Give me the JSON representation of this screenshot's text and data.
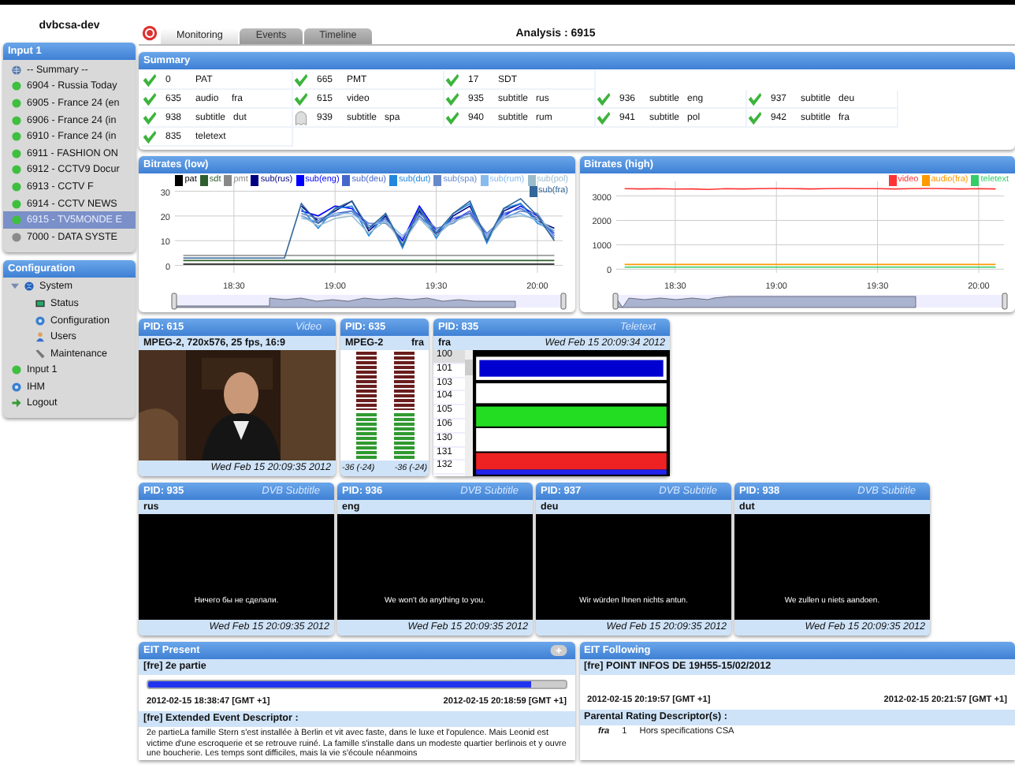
{
  "host": "dvbcsa-dev",
  "input_panel": {
    "title": "Input 1",
    "items": [
      {
        "label": "-- Summary --",
        "kind": "summary",
        "selected": false
      },
      {
        "label": "6904 - Russia Today",
        "kind": "service",
        "color": "#3fbf3f",
        "selected": false
      },
      {
        "label": "6905 - France 24 (en",
        "kind": "service",
        "color": "#3fbf3f",
        "selected": false
      },
      {
        "label": "6906 - France 24 (in",
        "kind": "service",
        "color": "#3fbf3f",
        "selected": false
      },
      {
        "label": "6910 - France 24 (in",
        "kind": "service",
        "color": "#3fbf3f",
        "selected": false
      },
      {
        "label": "6911 - FASHION ON",
        "kind": "service",
        "color": "#3fbf3f",
        "selected": false
      },
      {
        "label": "6912 - CCTV9 Docur",
        "kind": "service",
        "color": "#3fbf3f",
        "selected": false
      },
      {
        "label": "6913 - CCTV F",
        "kind": "service",
        "color": "#3fbf3f",
        "selected": false
      },
      {
        "label": "6914 - CCTV NEWS",
        "kind": "service",
        "color": "#3fbf3f",
        "selected": false
      },
      {
        "label": "6915 - TV5MONDE E",
        "kind": "service",
        "color": "#3fbf3f",
        "selected": true
      },
      {
        "label": "7000 - DATA SYSTE",
        "kind": "service",
        "color": "#8a8a8a",
        "selected": false
      }
    ]
  },
  "config_panel": {
    "title": "Configuration",
    "items": [
      {
        "label": "System",
        "kind": "system",
        "expanded": true,
        "children": [
          {
            "label": "Status",
            "kind": "status"
          },
          {
            "label": "Configuration",
            "kind": "gear"
          },
          {
            "label": "Users",
            "kind": "user"
          },
          {
            "label": "Maintenance",
            "kind": "wrench"
          }
        ]
      },
      {
        "label": "Input 1",
        "kind": "input"
      },
      {
        "label": "IHM",
        "kind": "gear"
      },
      {
        "label": "Logout",
        "kind": "logout"
      }
    ]
  },
  "tabs": [
    {
      "label": "Monitoring",
      "selected": true
    },
    {
      "label": "Events",
      "selected": false
    },
    {
      "label": "Timeline",
      "selected": false
    }
  ],
  "analysis_title": "Analysis : 6915",
  "summary": {
    "title": "Summary",
    "rows": [
      [
        {
          "pid": "0",
          "type": "PAT",
          "ok": true
        },
        {
          "pid": "665",
          "type": "PMT",
          "ok": true
        },
        {
          "pid": "17",
          "type": "SDT",
          "ok": true
        }
      ],
      [
        {
          "pid": "635",
          "type": "audio",
          "lang": "fra",
          "ok": true
        },
        {
          "pid": "615",
          "type": "video",
          "ok": true
        },
        {
          "pid": "935",
          "type": "subtitle",
          "lang": "rus",
          "ok": true
        },
        {
          "pid": "936",
          "type": "subtitle",
          "lang": "eng",
          "ok": true
        },
        {
          "pid": "937",
          "type": "subtitle",
          "lang": "deu",
          "ok": true
        }
      ],
      [
        {
          "pid": "938",
          "type": "subtitle",
          "lang": "dut",
          "ok": true
        },
        {
          "pid": "939",
          "type": "subtitle",
          "lang": "spa",
          "ok": false
        },
        {
          "pid": "940",
          "type": "subtitle",
          "lang": "rum",
          "ok": true
        },
        {
          "pid": "941",
          "type": "subtitle",
          "lang": "pol",
          "ok": true
        },
        {
          "pid": "942",
          "type": "subtitle",
          "lang": "fra",
          "ok": true
        }
      ],
      [
        {
          "pid": "835",
          "type": "teletext",
          "ok": true
        }
      ]
    ]
  },
  "bitrates_low": {
    "title": "Bitrates (low)",
    "chart_data": {
      "type": "line",
      "categories": [
        null,
        null,
        null,
        "18:30",
        null,
        null,
        null,
        null,
        null,
        "19:00",
        null,
        null,
        null,
        null,
        null,
        "19:30",
        null,
        null,
        null,
        null,
        null,
        "20:00",
        null
      ],
      "ylim": [
        -3,
        34
      ],
      "yticks": [
        0,
        10,
        20,
        30
      ],
      "grid": true,
      "legend": "top-right",
      "series": [
        {
          "name": "pat",
          "color": "#000000",
          "values": [
            0.5,
            0.5,
            0.5,
            0.5,
            0.5,
            0.5,
            0.5,
            0.5,
            0.5,
            0.5,
            0.5,
            0.5,
            0.5,
            0.5,
            0.5,
            0.5,
            0.5,
            0.5,
            0.5,
            0.5,
            0.5,
            0.5,
            0.5
          ]
        },
        {
          "name": "sdt",
          "color": "#2e5e2e",
          "values": [
            2,
            2,
            2,
            2,
            2,
            2,
            2,
            2,
            2,
            2,
            2,
            2,
            2,
            2,
            2,
            2,
            2,
            2,
            2,
            2,
            2,
            2,
            2
          ]
        },
        {
          "name": "pmt",
          "color": "#888888",
          "values": [
            4,
            4,
            4,
            4,
            4,
            4,
            4,
            4,
            4,
            4,
            4,
            4,
            4,
            4,
            4,
            4,
            4,
            4,
            4,
            4,
            4,
            4,
            4
          ]
        },
        {
          "name": "sub(rus)",
          "color": "#000080",
          "values": [
            null,
            null,
            null,
            null,
            null,
            null,
            null,
            24,
            18,
            22,
            26,
            14,
            20,
            8,
            22,
            12,
            20,
            24,
            10,
            22,
            25,
            18,
            15
          ]
        },
        {
          "name": "sub(eng)",
          "color": "#0000ff",
          "values": [
            null,
            null,
            null,
            null,
            null,
            null,
            null,
            22,
            20,
            24,
            23,
            16,
            18,
            10,
            24,
            14,
            18,
            22,
            12,
            20,
            24,
            20,
            12
          ]
        },
        {
          "name": "sub(deu)",
          "color": "#4466cc",
          "values": [
            null,
            null,
            null,
            null,
            null,
            null,
            null,
            20,
            17,
            21,
            22,
            15,
            19,
            9,
            20,
            13,
            19,
            21,
            11,
            21,
            23,
            19,
            13
          ]
        },
        {
          "name": "sub(dut)",
          "color": "#2288dd",
          "values": [
            null,
            null,
            null,
            null,
            null,
            null,
            null,
            23,
            15,
            23,
            24,
            12,
            21,
            7,
            23,
            11,
            21,
            25,
            9,
            23,
            25,
            17,
            14
          ]
        },
        {
          "name": "sub(spa)",
          "color": "#6688cc",
          "values": [
            null,
            null,
            null,
            null,
            null,
            null,
            null,
            21,
            19,
            20,
            22,
            17,
            17,
            11,
            21,
            15,
            17,
            22,
            13,
            19,
            22,
            21,
            11
          ]
        },
        {
          "name": "sub(rum)",
          "color": "#88bbee",
          "values": [
            null,
            null,
            null,
            null,
            null,
            null,
            null,
            19,
            18,
            21,
            21,
            16,
            18,
            12,
            19,
            14,
            18,
            20,
            12,
            20,
            21,
            18,
            12
          ]
        },
        {
          "name": "sub(pol)",
          "color": "#99bbcc",
          "values": [
            null,
            null,
            null,
            null,
            null,
            null,
            null,
            20,
            16,
            19,
            20,
            13,
            18,
            9,
            19,
            12,
            18,
            20,
            11,
            19,
            20,
            19,
            14
          ]
        },
        {
          "name": "sub(fra)",
          "color": "#336699",
          "values": [
            3,
            3,
            3,
            3,
            3,
            3,
            3,
            25,
            17,
            23,
            26,
            15,
            21,
            8,
            23,
            13,
            21,
            26,
            10,
            23,
            27,
            20,
            10
          ]
        }
      ]
    }
  },
  "bitrates_high": {
    "title": "Bitrates (high)",
    "chart_data": {
      "type": "line",
      "categories": [
        null,
        null,
        null,
        "18:30",
        null,
        null,
        null,
        null,
        null,
        "19:00",
        null,
        null,
        null,
        null,
        null,
        "19:30",
        null,
        null,
        null,
        null,
        null,
        "20:00",
        null
      ],
      "ylim": [
        -150,
        3600
      ],
      "yticks": [
        0,
        1000,
        2000,
        3000
      ],
      "grid": true,
      "legend": "top-right",
      "series": [
        {
          "name": "video",
          "color": "#ff3333",
          "values": [
            3300,
            3290,
            3300,
            3280,
            3290,
            3270,
            3300,
            3290,
            3300,
            3310,
            3300,
            3290,
            3300,
            3310,
            3300,
            3300,
            3290,
            3300,
            3310,
            3300,
            3290,
            3300,
            3290
          ]
        },
        {
          "name": "audio(fra)",
          "color": "#ff9900",
          "values": [
            190,
            190,
            190,
            190,
            190,
            190,
            190,
            190,
            190,
            190,
            190,
            190,
            190,
            190,
            190,
            190,
            190,
            190,
            190,
            190,
            190,
            190,
            190
          ]
        },
        {
          "name": "teletext",
          "color": "#33cc66",
          "values": [
            80,
            80,
            80,
            80,
            80,
            80,
            80,
            80,
            80,
            80,
            80,
            80,
            80,
            80,
            80,
            80,
            80,
            80,
            80,
            80,
            80,
            80,
            80
          ]
        }
      ]
    }
  },
  "video": {
    "pid": "PID: 615",
    "kind_label": "Video",
    "format": "MPEG-2, 720x576, 25 fps, 16:9",
    "timestamp": "Wed Feb 15 20:09:35 2012"
  },
  "audio": {
    "pid": "PID: 635",
    "codec": "MPEG-2",
    "lang": "fra",
    "channels": [
      {
        "level": 0.42,
        "reading": "-36 (-24)"
      },
      {
        "level": 0.42,
        "reading": "-36 (-24)"
      }
    ]
  },
  "teletext": {
    "pid": "PID: 835",
    "kind_label": "Teletext",
    "lang": "fra",
    "timestamp": "Wed Feb 15 20:09:34 2012",
    "pages": [
      {
        "label": "100",
        "selected": true
      },
      {
        "label": "101",
        "selected": false
      },
      {
        "label": "103",
        "selected": false
      },
      {
        "label": "104",
        "selected": false
      },
      {
        "label": "105",
        "selected": false
      },
      {
        "label": "106",
        "selected": false
      },
      {
        "label": "130",
        "selected": false
      },
      {
        "label": "131",
        "selected": false
      },
      {
        "label": "132",
        "selected": false
      }
    ]
  },
  "subtitles": [
    {
      "pid": "PID: 935",
      "kind_label": "DVB Subtitle",
      "lang": "rus",
      "text": "Ничего бы не сделали.",
      "timestamp": "Wed Feb 15 20:09:35 2012"
    },
    {
      "pid": "PID: 936",
      "kind_label": "DVB Subtitle",
      "lang": "eng",
      "text": "We won't do anything to you.",
      "timestamp": "Wed Feb 15 20:09:35 2012"
    },
    {
      "pid": "PID: 937",
      "kind_label": "DVB Subtitle",
      "lang": "deu",
      "text": "Wir würden Ihnen nichts antun.",
      "timestamp": "Wed Feb 15 20:09:35 2012"
    },
    {
      "pid": "PID: 938",
      "kind_label": "DVB Subtitle",
      "lang": "dut",
      "text": "We zullen u niets aandoen.",
      "timestamp": "Wed Feb 15 20:09:35 2012"
    }
  ],
  "eit_present": {
    "title": "EIT Present",
    "event": "[fre] 2e partie",
    "level": 0.92,
    "start": "2012-02-15 18:38:47 [GMT +1]",
    "end": "2012-02-15 20:18:59 [GMT +1]",
    "descriptor_title": "[fre] Extended Event Descriptor :",
    "description": "2e partieLa famille Stern s'est installée à Berlin et vit avec faste, dans le luxe et l'opulence. Mais Leonid est victime d'une escroquerie et se retrouve ruiné. La famille s'installe dans un modeste quartier berlinois et y ouvre une boucherie. Les temps sont difficiles, mais la vie s'écoule néanmoins"
  },
  "eit_following": {
    "title": "EIT Following",
    "event": "[fre] POINT INFOS DE 19H55-15/02/2012",
    "start": "2012-02-15 20:19:57 [GMT +1]",
    "end": "2012-02-15 20:21:57 [GMT +1]",
    "descriptor_title": "Parental Rating Descriptor(s) :",
    "ratings": [
      {
        "lang": "fra",
        "value": "1",
        "text": "Hors specifications CSA"
      }
    ]
  }
}
